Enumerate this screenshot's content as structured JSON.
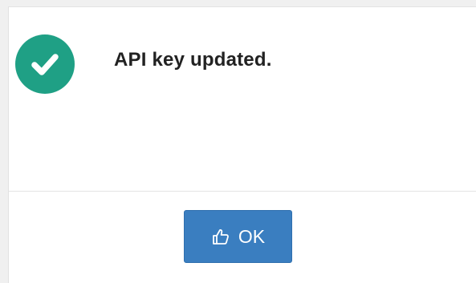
{
  "dialog": {
    "message": "API key updated.",
    "status_icon": "check-circle-icon",
    "status_color": "#1fa085"
  },
  "footer": {
    "ok_button": {
      "label": "OK",
      "icon": "thumbs-up-icon",
      "color": "#3a7ec0"
    }
  }
}
